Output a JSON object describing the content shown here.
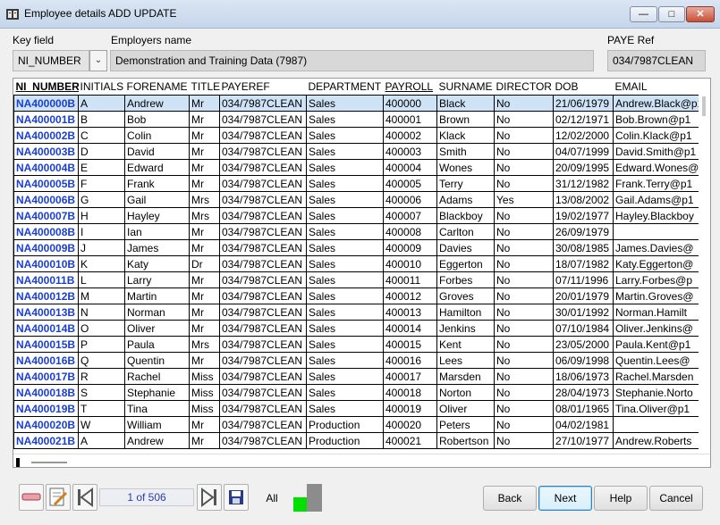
{
  "window": {
    "title": "Employee details ADD UPDATE"
  },
  "form": {
    "key_label": "Key field",
    "key_value": "NI_NUMBER",
    "employer_label": "Employers name",
    "employer_value": "Demonstration and Training Data (7987)",
    "paye_label": "PAYE Ref",
    "paye_value": "034/7987CLEAN"
  },
  "grid": {
    "columns": [
      "NI_NUMBER",
      "INITIALS",
      "FORENAME",
      "TITLE",
      "PAYEREF",
      "DEPARTMENT",
      "PAYROLL",
      "SURNAME",
      "DIRECTOR",
      "DOB",
      "EMAIL"
    ],
    "rows": [
      [
        "NA400000B",
        "A",
        "Andrew",
        "Mr",
        "034/7987CLEAN",
        "Sales",
        "400000",
        "Black",
        "No",
        "21/06/1979",
        "Andrew.Black@p1"
      ],
      [
        "NA400001B",
        "B",
        "Bob",
        "Mr",
        "034/7987CLEAN",
        "Sales",
        "400001",
        "Brown",
        "No",
        "02/12/1971",
        "Bob.Brown@p1"
      ],
      [
        "NA400002B",
        "C",
        "Colin",
        "Mr",
        "034/7987CLEAN",
        "Sales",
        "400002",
        "Klack",
        "No",
        "12/02/2000",
        "Colin.Klack@p1"
      ],
      [
        "NA400003B",
        "D",
        "David",
        "Mr",
        "034/7987CLEAN",
        "Sales",
        "400003",
        "Smith",
        "No",
        "04/07/1999",
        "David.Smith@p1"
      ],
      [
        "NA400004B",
        "E",
        "Edward",
        "Mr",
        "034/7987CLEAN",
        "Sales",
        "400004",
        "Wones",
        "No",
        "20/09/1995",
        "Edward.Wones@"
      ],
      [
        "NA400005B",
        "F",
        "Frank",
        "Mr",
        "034/7987CLEAN",
        "Sales",
        "400005",
        "Terry",
        "No",
        "31/12/1982",
        "Frank.Terry@p1"
      ],
      [
        "NA400006B",
        "G",
        "Gail",
        "Mrs",
        "034/7987CLEAN",
        "Sales",
        "400006",
        "Adams",
        "Yes",
        "13/08/2002",
        "Gail.Adams@p1"
      ],
      [
        "NA400007B",
        "H",
        "Hayley",
        "Mrs",
        "034/7987CLEAN",
        "Sales",
        "400007",
        "Blackboy",
        "No",
        "19/02/1977",
        "Hayley.Blackboy"
      ],
      [
        "NA400008B",
        "I",
        "Ian",
        "Mr",
        "034/7987CLEAN",
        "Sales",
        "400008",
        "Carlton",
        "No",
        "26/09/1979",
        ""
      ],
      [
        "NA400009B",
        "J",
        "James",
        "Mr",
        "034/7987CLEAN",
        "Sales",
        "400009",
        "Davies",
        "No",
        "30/08/1985",
        "James.Davies@"
      ],
      [
        "NA400010B",
        "K",
        "Katy",
        "Dr",
        "034/7987CLEAN",
        "Sales",
        "400010",
        "Eggerton",
        "No",
        "18/07/1982",
        "Katy.Eggerton@"
      ],
      [
        "NA400011B",
        "L",
        "Larry",
        "Mr",
        "034/7987CLEAN",
        "Sales",
        "400011",
        "Forbes",
        "No",
        "07/11/1996",
        "Larry.Forbes@p"
      ],
      [
        "NA400012B",
        "M",
        "Martin",
        "Mr",
        "034/7987CLEAN",
        "Sales",
        "400012",
        "Groves",
        "No",
        "20/01/1979",
        "Martin.Groves@"
      ],
      [
        "NA400013B",
        "N",
        "Norman",
        "Mr",
        "034/7987CLEAN",
        "Sales",
        "400013",
        "Hamilton",
        "No",
        "30/01/1992",
        "Norman.Hamilt"
      ],
      [
        "NA400014B",
        "O",
        "Oliver",
        "Mr",
        "034/7987CLEAN",
        "Sales",
        "400014",
        "Jenkins",
        "No",
        "07/10/1984",
        "Oliver.Jenkins@"
      ],
      [
        "NA400015B",
        "P",
        "Paula",
        "Mrs",
        "034/7987CLEAN",
        "Sales",
        "400015",
        "Kent",
        "No",
        "23/05/2000",
        "Paula.Kent@p1"
      ],
      [
        "NA400016B",
        "Q",
        "Quentin",
        "Mr",
        "034/7987CLEAN",
        "Sales",
        "400016",
        "Lees",
        "No",
        "06/09/1998",
        "Quentin.Lees@"
      ],
      [
        "NA400017B",
        "R",
        "Rachel",
        "Miss",
        "034/7987CLEAN",
        "Sales",
        "400017",
        "Marsden",
        "No",
        "18/06/1973",
        "Rachel.Marsden"
      ],
      [
        "NA400018B",
        "S",
        "Stephanie",
        "Miss",
        "034/7987CLEAN",
        "Sales",
        "400018",
        "Norton",
        "No",
        "28/04/1973",
        "Stephanie.Norto"
      ],
      [
        "NA400019B",
        "T",
        "Tina",
        "Miss",
        "034/7987CLEAN",
        "Sales",
        "400019",
        "Oliver",
        "No",
        "08/01/1965",
        "Tina.Oliver@p1"
      ],
      [
        "NA400020B",
        "W",
        "William",
        "Mr",
        "034/7987CLEAN",
        "Production",
        "400020",
        "Peters",
        "No",
        "04/02/1981",
        ""
      ],
      [
        "NA400021B",
        "A",
        "Andrew",
        "Mr",
        "034/7987CLEAN",
        "Production",
        "400021",
        "Robertson",
        "No",
        "27/10/1977",
        "Andrew.Roberts"
      ]
    ]
  },
  "nav": {
    "page_indicator": "1 of 506",
    "all_label": "All"
  },
  "buttons": {
    "back": "Back",
    "next": "Next",
    "help": "Help",
    "cancel": "Cancel"
  },
  "colors": {
    "key_text": "#1a3fd0",
    "selected_row": "#cfe3f7",
    "status_green": "#00e000"
  }
}
